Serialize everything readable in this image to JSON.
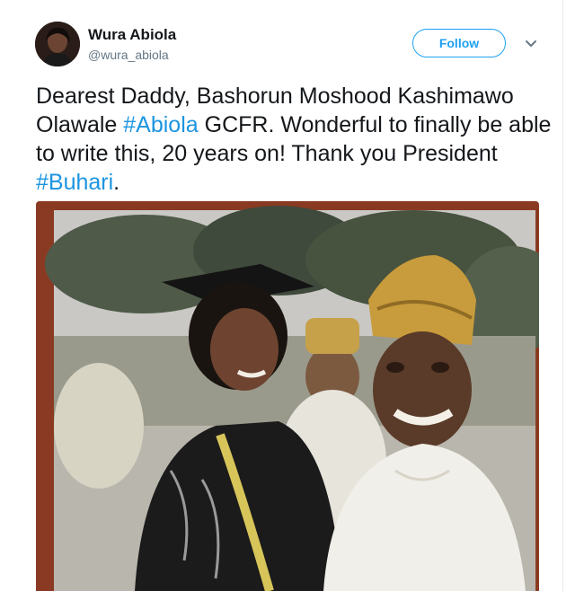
{
  "user": {
    "display_name": "Wura Abiola",
    "handle": "@wura_abiola",
    "avatar_icon": "profile-photo"
  },
  "actions": {
    "follow_label": "Follow",
    "more_icon": "chevron-down-icon"
  },
  "tweet": {
    "segments": [
      {
        "text": "Dearest Daddy, Bashorun Moshood Kashimawo Olawale ",
        "hashtag": false
      },
      {
        "text": "#Abiola",
        "hashtag": true
      },
      {
        "text": " GCFR. Wonderful to finally be able to write this, 20 years on! Thank you President ",
        "hashtag": false
      },
      {
        "text": "#Buhari",
        "hashtag": true
      },
      {
        "text": ".",
        "hashtag": false
      }
    ]
  },
  "colors": {
    "accent": "#1da1f2",
    "hashtag": "#1b95e0",
    "text": "#14171a",
    "muted": "#657786"
  },
  "media": {
    "type": "photo"
  }
}
